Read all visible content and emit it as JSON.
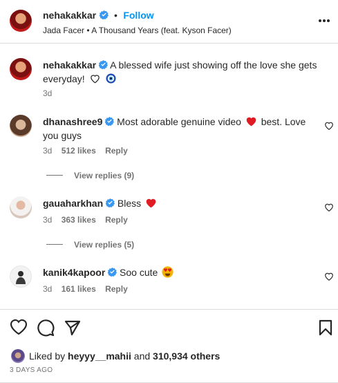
{
  "header": {
    "username": "nehakakkar",
    "dot": "•",
    "follow_label": "Follow",
    "audio": "Jada Facer • A Thousand Years (feat. Kyson Facer)"
  },
  "caption": {
    "username": "nehakakkar",
    "text": "A blessed wife just showing off the love she gets everyday!",
    "time": "3d"
  },
  "comments": [
    {
      "username": "dhanashree9",
      "text_before": "Most adorable genuine video",
      "text_after": "best. Love you guys",
      "time": "3d",
      "likes": "512 likes",
      "reply": "Reply",
      "view_replies": "View replies (9)"
    },
    {
      "username": "gauaharkhan",
      "text_before": "Bless",
      "time": "3d",
      "likes": "363 likes",
      "reply": "Reply",
      "view_replies": "View replies (5)"
    },
    {
      "username": "kanik4kapoor",
      "text_before": "Soo cute",
      "time": "3d",
      "likes": "161 likes",
      "reply": "Reply"
    }
  ],
  "footer": {
    "liked_by_prefix": "Liked by",
    "liked_by_user": "heyyy__mahii",
    "liked_by_mid": "and",
    "liked_by_count": "310,934 others",
    "date": "3 DAYS AGO"
  },
  "colors": {
    "accent": "#0095f6",
    "verified": "#3897f0",
    "heart_red": "#ed4956"
  },
  "icons": [
    "verified-icon",
    "more-icon",
    "heart-icon",
    "comment-icon",
    "share-icon",
    "bookmark-icon",
    "nazar-icon",
    "smile-emoji-icon"
  ]
}
